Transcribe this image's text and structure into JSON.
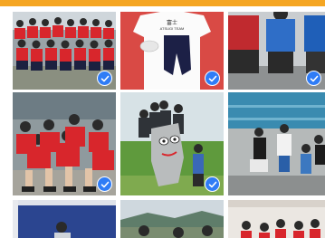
{
  "accent_color": "#f5a623",
  "check_color": "#2f7cf6",
  "photos": [
    {
      "label": "team-photo-red-shirts",
      "selected": true
    },
    {
      "label": "uniform-shirt-and-shorts",
      "selected": true
    },
    {
      "label": "athletes-standing",
      "selected": true
    },
    {
      "label": "group-sitting-red-shirts",
      "selected": true
    },
    {
      "label": "kids-with-mascot",
      "selected": true
    },
    {
      "label": "poolside-award",
      "selected": false
    },
    {
      "label": "blue-banner-event",
      "selected": false
    },
    {
      "label": "outdoor-group",
      "selected": false
    },
    {
      "label": "indoor-group-red-shirts",
      "selected": false
    }
  ],
  "shirt_text": {
    "line1": "富士",
    "line2": "ATSUGI TEAM"
  }
}
